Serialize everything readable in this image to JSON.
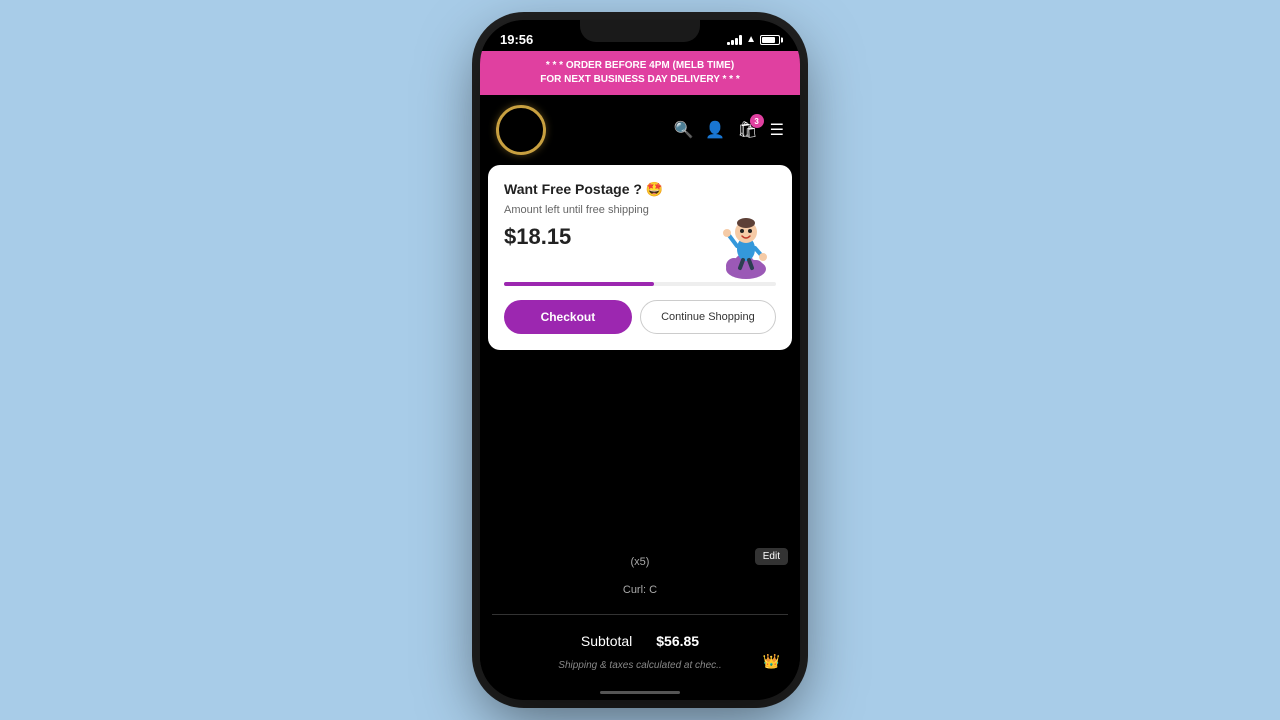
{
  "phone": {
    "time": "19:56",
    "battery_level": 80,
    "cart_count": "3"
  },
  "banner": {
    "line1": "* * * ORDER BEFORE 4PM (MELB TIME)",
    "line2": "FOR NEXT BUSINESS DAY DELIVERY * * *"
  },
  "modal": {
    "title": "Want Free Postage ? 🤩",
    "subtitle": "Amount left until free shipping",
    "amount": "$18.15",
    "progress_percent": 55,
    "checkout_label": "Checkout",
    "continue_label": "Continue Shopping"
  },
  "cart": {
    "item_qty": "(x5)",
    "item_detail": "Curl: C",
    "edit_label": "Edit",
    "subtotal_label": "Subtotal",
    "subtotal_amount": "$56.85",
    "shipping_note": "Shipping & taxes calculated at chec.."
  }
}
